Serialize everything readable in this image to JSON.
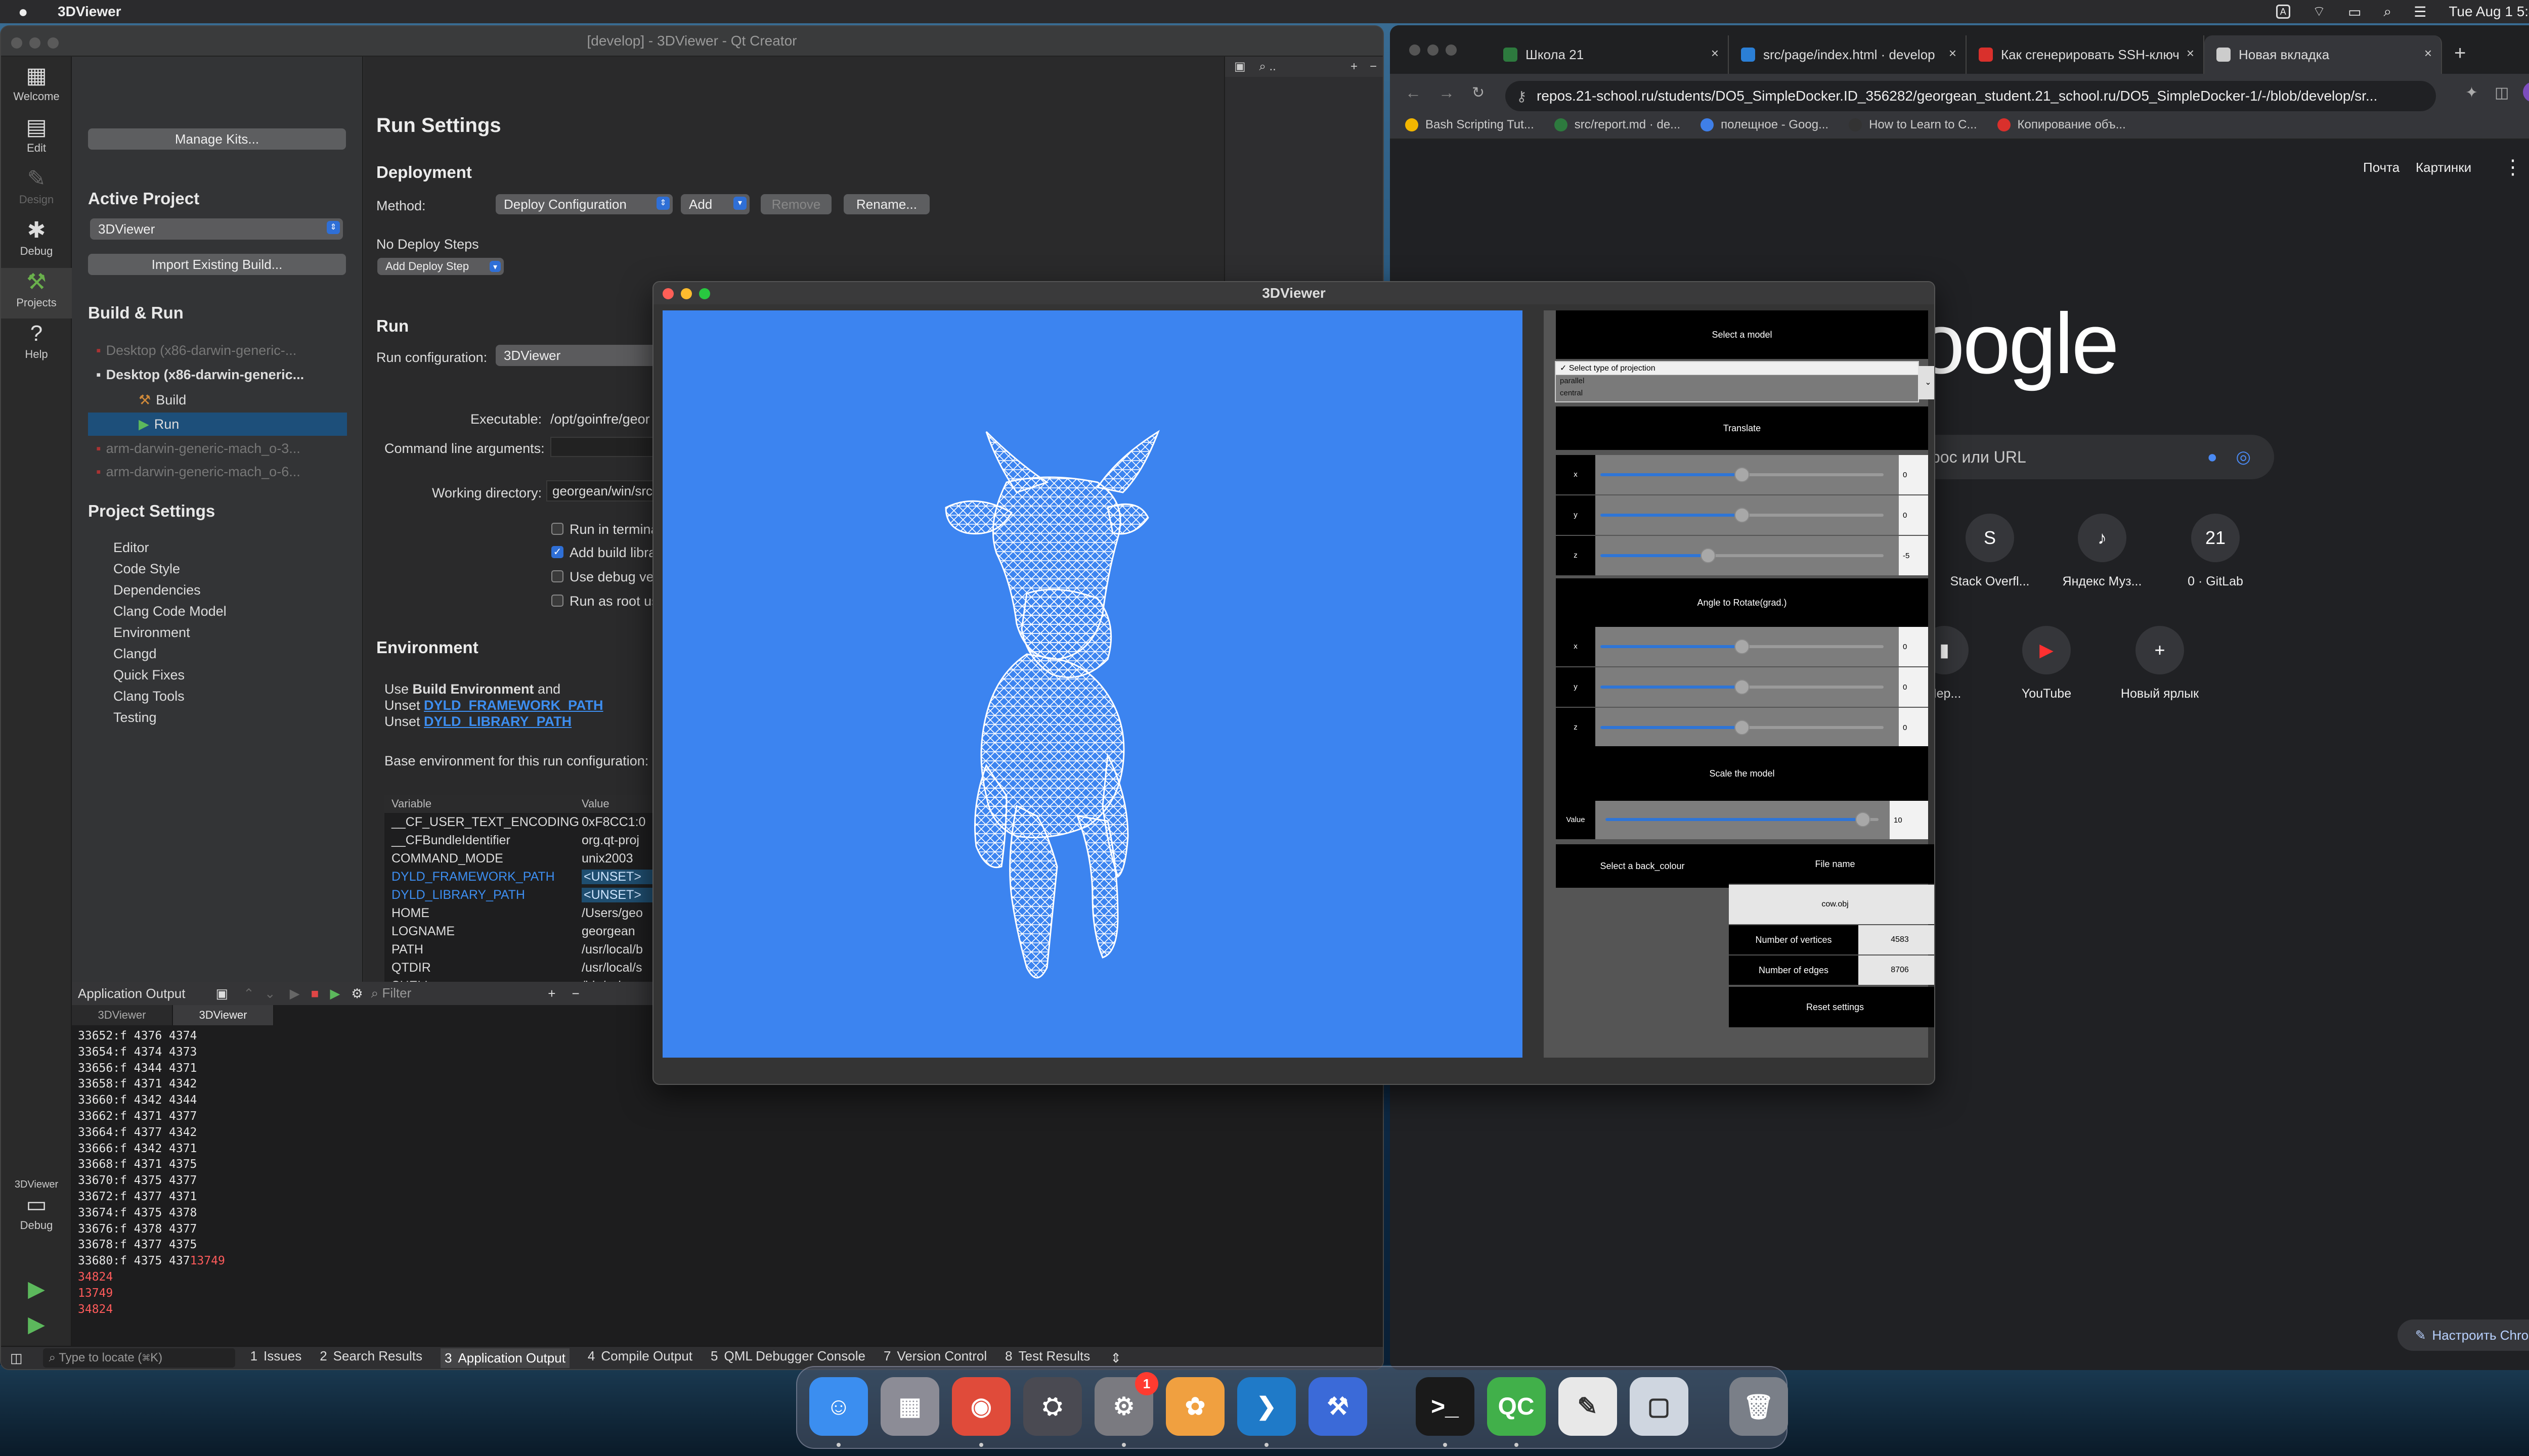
{
  "menubar": {
    "app_name": "3DViewer",
    "datetime": "Tue Aug 1  5:44 PM",
    "input_source": "A"
  },
  "qt": {
    "title": "[develop] - 3DViewer - Qt Creator",
    "modes": [
      {
        "label": "Welcome",
        "icon": "grid-icon"
      },
      {
        "label": "Edit",
        "icon": "document-icon"
      },
      {
        "label": "Design",
        "icon": "pen-icon"
      },
      {
        "label": "Debug",
        "icon": "bug-icon"
      },
      {
        "label": "Projects",
        "icon": "wrench-icon"
      },
      {
        "label": "Help",
        "icon": "help-icon"
      }
    ],
    "kit_selector": {
      "name": "3DViewer",
      "label": "Debug"
    },
    "nav": {
      "manage_kits": "Manage Kits...",
      "active_project_heading": "Active Project",
      "active_project_value": "3DViewer",
      "import_build": "Import Existing Build...",
      "build_run_heading": "Build & Run",
      "kits": [
        {
          "label": "Desktop (x86-darwin-generic-...",
          "dim": true
        },
        {
          "label": "Desktop (x86-darwin-generic...",
          "dim": false
        },
        {
          "label": "Build",
          "dim": false
        },
        {
          "label": "Run",
          "dim": false
        },
        {
          "label": "arm-darwin-generic-mach_o-3...",
          "dim": true
        },
        {
          "label": "arm-darwin-generic-mach_o-6...",
          "dim": true
        }
      ],
      "project_settings_heading": "Project Settings",
      "settings_items": [
        "Editor",
        "Code Style",
        "Dependencies",
        "Clang Code Model",
        "Environment",
        "Clangd",
        "Quick Fixes",
        "Clang Tools",
        "Testing"
      ]
    },
    "run_settings": {
      "heading": "Run Settings",
      "deployment_heading": "Deployment",
      "method_label": "Method:",
      "method_value": "Deploy Configuration",
      "add_label": "Add",
      "remove_label": "Remove",
      "rename_label": "Rename...",
      "no_deploy_steps": "No Deploy Steps",
      "add_deploy_step": "Add Deploy Step",
      "run_heading": "Run",
      "run_config_label": "Run configuration:",
      "run_config_value": "3DViewer",
      "executable_label": "Executable:",
      "executable_value": "/opt/goinfre/geor",
      "cmd_args_label": "Command line arguments:",
      "workdir_label": "Working directory:",
      "workdir_value": "georgean/win/src",
      "checkboxes": [
        {
          "label": "Run in termina",
          "checked": false
        },
        {
          "label": "Add build libra",
          "checked": true
        },
        {
          "label": "Use debug ve",
          "checked": false
        },
        {
          "label": "Run as root us",
          "checked": false
        }
      ],
      "environment_heading": "Environment",
      "env_use_prefix": "Use ",
      "env_use_bold": "Build Environment",
      "env_use_suffix": " and",
      "env_unset_label": "Unset ",
      "env_unset_1": "DYLD_FRAMEWORK_PATH",
      "env_unset_2": "DYLD_LIBRARY_PATH",
      "base_env_label": "Base environment for this run configuration:",
      "table_headers": [
        "Variable",
        "Value"
      ],
      "table_rows": [
        {
          "var": "__CF_USER_TEXT_ENCODING",
          "val": "0xF8CC1:0",
          "hl": false
        },
        {
          "var": "__CFBundleIdentifier",
          "val": "org.qt-proj",
          "hl": false
        },
        {
          "var": "COMMAND_MODE",
          "val": "unix2003",
          "hl": false
        },
        {
          "var": "DYLD_FRAMEWORK_PATH",
          "val": "<UNSET>",
          "hl": true
        },
        {
          "var": "DYLD_LIBRARY_PATH",
          "val": "<UNSET>",
          "hl": true
        },
        {
          "var": "HOME",
          "val": "/Users/geo",
          "hl": false
        },
        {
          "var": "LOGNAME",
          "val": "georgean",
          "hl": false
        },
        {
          "var": "PATH",
          "val": "/usr/local/b",
          "hl": false
        },
        {
          "var": "QTDIR",
          "val": "/usr/local/s",
          "hl": false
        },
        {
          "var": "SHELL",
          "val": "/bin/zsh",
          "hl": false
        }
      ]
    },
    "output": {
      "title": "Application Output",
      "filter_placeholder": "Filter",
      "tabs": [
        "3DViewer",
        "3DViewer"
      ],
      "lines": [
        {
          "t": "33652:f 4376 4374",
          "red": ""
        },
        {
          "t": "33654:f 4374 4373",
          "red": ""
        },
        {
          "t": "33656:f 4344 4371",
          "red": ""
        },
        {
          "t": "33658:f 4371 4342",
          "red": ""
        },
        {
          "t": "33660:f 4342 4344",
          "red": ""
        },
        {
          "t": "33662:f 4371 4377",
          "red": ""
        },
        {
          "t": "33664:f 4377 4342",
          "red": ""
        },
        {
          "t": "33666:f 4342 4371",
          "red": ""
        },
        {
          "t": "33668:f 4371 4375",
          "red": ""
        },
        {
          "t": "33670:f 4375 4377",
          "red": ""
        },
        {
          "t": "33672:f 4377 4371",
          "red": ""
        },
        {
          "t": "33674:f 4375 4378",
          "red": ""
        },
        {
          "t": "33676:f 4378 4377",
          "red": ""
        },
        {
          "t": "33678:f 4377 4375",
          "red": ""
        },
        {
          "t": "33680:f 4375 437",
          "red": "13749"
        },
        {
          "t": "",
          "red": "34824"
        },
        {
          "t": "",
          "red": "13749"
        },
        {
          "t": "",
          "red": "34824"
        }
      ]
    },
    "status": {
      "locator_placeholder": "Type to locate (⌘K)",
      "tabs": [
        {
          "n": "1",
          "label": "Issues"
        },
        {
          "n": "2",
          "label": "Search Results"
        },
        {
          "n": "3",
          "label": "Application Output"
        },
        {
          "n": "4",
          "label": "Compile Output"
        },
        {
          "n": "5",
          "label": "QML Debugger Console"
        },
        {
          "n": "7",
          "label": "Version Control"
        },
        {
          "n": "8",
          "label": "Test Results"
        }
      ]
    }
  },
  "chrome": {
    "tabs": [
      {
        "label": "Школа 21",
        "color": "#2d7a3e"
      },
      {
        "label": "src/page/index.html · develop",
        "color": "#2b7fd6"
      },
      {
        "label": "Как сгенерировать SSH-ключ",
        "color": "#d9302c"
      },
      {
        "label": "Новая вкладка",
        "color": "#cccccc"
      }
    ],
    "url": "repos.21-school.ru/students/DO5_SimpleDocker.ID_356282/georgean_student.21_school.ru/DO5_SimpleDocker-1/-/blob/develop/sr...",
    "url_host": "repos.21-school.ru",
    "bookmarks": [
      {
        "label": "Bash Scripting Tut...",
        "color": "#f2b600"
      },
      {
        "label": "src/report.md · de...",
        "color": "#2d7a3e"
      },
      {
        "label": "полещное - Goog...",
        "color": "#3f7fe8"
      },
      {
        "label": "How to Learn to C...",
        "color": "#333333"
      },
      {
        "label": "Копирование объ...",
        "color": "#d9302c"
      }
    ],
    "top_links": [
      "Почта",
      "Картинки"
    ],
    "avatar": "D",
    "logo_text": "oogle",
    "search_placeholder": "рос или URL",
    "shortcuts": [
      {
        "label": "Stack Overfl...",
        "glyph": "S"
      },
      {
        "label": "Яндекс Муз...",
        "glyph": "♪"
      },
      {
        "label": "0 · GitLab",
        "glyph": "21"
      },
      {
        "label": "Пер...",
        "glyph": "▮"
      },
      {
        "label": "YouTube",
        "glyph": "▶"
      },
      {
        "label": "Новый ярлык",
        "glyph": "+"
      }
    ],
    "customize_label": "Настроить Chrome"
  },
  "viewer": {
    "title": "3DViewer",
    "select_model": "Select a model",
    "projection_options": [
      "Select type of projection",
      "parallel",
      "central"
    ],
    "translate_heading": "Translate",
    "translate": [
      {
        "axis": "x",
        "value": "0",
        "level": 0.5
      },
      {
        "axis": "y",
        "value": "0",
        "level": 0.5
      },
      {
        "axis": "z",
        "value": "-5",
        "level": 0.38
      }
    ],
    "rotate_heading": "Angle to Rotate(grad.)",
    "rotate": [
      {
        "axis": "x",
        "value": "0",
        "level": 0.5
      },
      {
        "axis": "y",
        "value": "0",
        "level": 0.5
      },
      {
        "axis": "z",
        "value": "0",
        "level": 0.5
      }
    ],
    "scale_heading": "Scale the model",
    "scale_label": "Value",
    "scale_value": "10",
    "scale_level": 0.97,
    "back_colour_button": "Select a back_colour",
    "file_name_label": "File name",
    "file_name_value": "cow.obj",
    "vertices_label": "Number of vertices",
    "vertices_value": "4583",
    "edges_label": "Number of edges",
    "edges_value": "8706",
    "reset_button": "Reset settings",
    "background_color": "#3c84f0"
  },
  "dock": [
    {
      "name": "finder",
      "glyph": "☺",
      "color": "#3b8ef0"
    },
    {
      "name": "launchpad",
      "glyph": "▦",
      "color": "#8c8c96"
    },
    {
      "name": "chrome",
      "glyph": "◉",
      "color": "#e04b3a"
    },
    {
      "name": "xcode-tools",
      "glyph": "⛭",
      "color": "#4a4a52"
    },
    {
      "name": "system-settings",
      "glyph": "⚙",
      "color": "#7a7a80",
      "badge": "1"
    },
    {
      "name": "photos",
      "glyph": "✿",
      "color": "#f0a040"
    },
    {
      "name": "vscode",
      "glyph": "❯",
      "color": "#1f7ac8"
    },
    {
      "name": "instruments",
      "glyph": "⚒",
      "color": "#3b6ad8"
    },
    {
      "name": "terminal",
      "glyph": ">_",
      "color": "#1a1a1a"
    },
    {
      "name": "qt-creator",
      "glyph": "QC",
      "color": "#41b04a"
    },
    {
      "name": "textedit",
      "glyph": "✎",
      "color": "#e8e8e8"
    },
    {
      "name": "preview",
      "glyph": "▢",
      "color": "#cfd6e0"
    },
    {
      "name": "trash",
      "glyph": "🗑",
      "color": "#7a7f88"
    }
  ]
}
